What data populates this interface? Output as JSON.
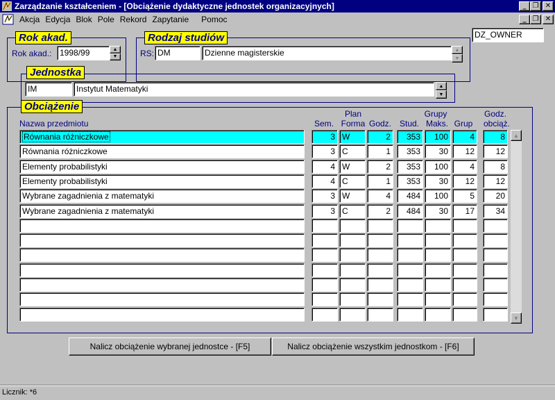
{
  "window": {
    "title": "Zarządzanie kształceniem - [Obciążenie dydaktyczne jednostek organizacyjnych]",
    "controls": {
      "minimize": "_",
      "restore": "❐",
      "close": "✕"
    }
  },
  "menu": [
    "Akcja",
    "Edycja",
    "Blok",
    "Pole",
    "Rekord",
    "Zapytanie",
    "Pomoc"
  ],
  "owner": "DZ_OWNER",
  "rok": {
    "legend": "Rok akad.",
    "label": "Rok akad.:",
    "value": "1998/99"
  },
  "rodzaj": {
    "legend": "Rodzaj studiów",
    "label": "RS:",
    "code": "DM",
    "name": "Dzienne magisterskie"
  },
  "jednostka": {
    "legend": "Jednostka",
    "code": "IM",
    "name": "Instytut Matematyki"
  },
  "obciazenie": {
    "legend": "Obciążenie",
    "headers": {
      "nazwa": "Nazwa przedmiotu",
      "sem": "Sem.",
      "plan": "Plan",
      "forma": "Forma",
      "godz": "Godz.",
      "stud": "Stud.",
      "grupy": "Grupy",
      "maks": "Maks.",
      "grup": "Grup",
      "godz_obc_1": "Godz.",
      "godz_obc_2": "obciąż."
    },
    "rows": [
      {
        "nazwa": "Równania różniczkowe",
        "sem": "3",
        "forma": "W",
        "godz": "2",
        "stud": "353",
        "maks": "100",
        "grup": "4",
        "obc": "8"
      },
      {
        "nazwa": "Równania różniczkowe",
        "sem": "3",
        "forma": "C",
        "godz": "1",
        "stud": "353",
        "maks": "30",
        "grup": "12",
        "obc": "12"
      },
      {
        "nazwa": "Elementy probabilistyki",
        "sem": "4",
        "forma": "W",
        "godz": "2",
        "stud": "353",
        "maks": "100",
        "grup": "4",
        "obc": "8"
      },
      {
        "nazwa": "Elementy probabilistyki",
        "sem": "4",
        "forma": "C",
        "godz": "1",
        "stud": "353",
        "maks": "30",
        "grup": "12",
        "obc": "12"
      },
      {
        "nazwa": "Wybrane zagadnienia z matematyki",
        "sem": "3",
        "forma": "W",
        "godz": "4",
        "stud": "484",
        "maks": "100",
        "grup": "5",
        "obc": "20"
      },
      {
        "nazwa": "Wybrane zagadnienia z matematyki",
        "sem": "3",
        "forma": "C",
        "godz": "2",
        "stud": "484",
        "maks": "30",
        "grup": "17",
        "obc": "34"
      },
      {
        "nazwa": "",
        "sem": "",
        "forma": "",
        "godz": "",
        "stud": "",
        "maks": "",
        "grup": "",
        "obc": ""
      },
      {
        "nazwa": "",
        "sem": "",
        "forma": "",
        "godz": "",
        "stud": "",
        "maks": "",
        "grup": "",
        "obc": ""
      },
      {
        "nazwa": "",
        "sem": "",
        "forma": "",
        "godz": "",
        "stud": "",
        "maks": "",
        "grup": "",
        "obc": ""
      },
      {
        "nazwa": "",
        "sem": "",
        "forma": "",
        "godz": "",
        "stud": "",
        "maks": "",
        "grup": "",
        "obc": ""
      },
      {
        "nazwa": "",
        "sem": "",
        "forma": "",
        "godz": "",
        "stud": "",
        "maks": "",
        "grup": "",
        "obc": ""
      },
      {
        "nazwa": "",
        "sem": "",
        "forma": "",
        "godz": "",
        "stud": "",
        "maks": "",
        "grup": "",
        "obc": ""
      },
      {
        "nazwa": "",
        "sem": "",
        "forma": "",
        "godz": "",
        "stud": "",
        "maks": "",
        "grup": "",
        "obc": ""
      }
    ]
  },
  "buttons": {
    "nalicz_wybranej": "Nalicz obciążenie wybranej jednostce - [F5]",
    "nalicz_wszystkim": "Nalicz obciążenie wszystkim jednostkom - [F6]"
  },
  "status": "Licznik: *6",
  "colors": {
    "title_bg": "#000080",
    "legend_bg": "#ffff00",
    "selected_row": "#00ffff",
    "label_text": "#000080"
  }
}
